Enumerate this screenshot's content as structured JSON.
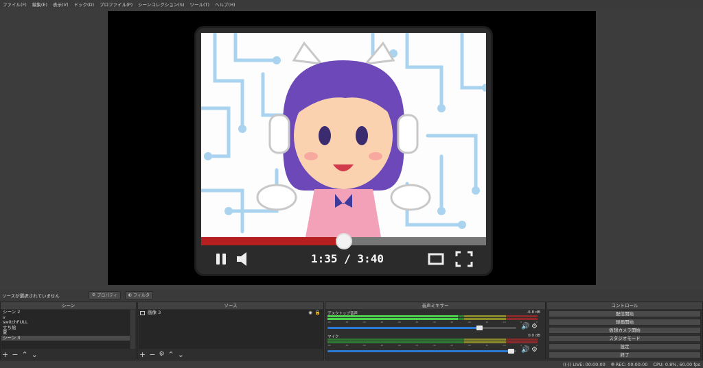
{
  "menu": [
    "ファイル(F)",
    "編集(E)",
    "表示(V)",
    "ドック(D)",
    "プロファイル(P)",
    "シーンコレクション(S)",
    "ツール(T)",
    "ヘルプ(H)"
  ],
  "status": {
    "no_source": "ソースが選択されていません",
    "properties": "プロパティ",
    "filters": "フィルタ"
  },
  "preview": {
    "time": "1:35 / 3:40",
    "progress": 0.5
  },
  "scenes": {
    "header": "シーン",
    "items": [
      "シーン 2",
      "v",
      "switchFULL",
      "立ち絵",
      "夏",
      "シーン 3"
    ],
    "selected_index": 5
  },
  "sources": {
    "header": "ソース",
    "items": [
      {
        "name": "画像 3"
      }
    ]
  },
  "mixer": {
    "header": "音声ミキサー",
    "channels": [
      {
        "name": "デスクトップ音声",
        "db": "-6.8 dB",
        "level": 0.62,
        "volume": 0.82
      },
      {
        "name": "マイク",
        "db": "0.0 dB",
        "level": 0.0,
        "volume": 0.99
      }
    ],
    "ticks": [
      "-60",
      "-55",
      "-50",
      "-45",
      "-40",
      "-35",
      "-30",
      "-25",
      "-20",
      "-15",
      "-10",
      "-5",
      "0"
    ]
  },
  "controls": {
    "header": "コントロール",
    "buttons": [
      "配信開始",
      "録画開始",
      "仮想カメラ開始",
      "スタジオモード",
      "設定",
      "終了"
    ]
  },
  "footer": {
    "live": "LIVE: 00:00:00",
    "rec": "REC: 00:00:00",
    "cpu": "CPU: 0.8%, 60.00 fps"
  },
  "colors": {
    "progress_red": "#b51f1f",
    "slider_blue": "#2a79d4",
    "hair_purple": "#6c48b8"
  }
}
